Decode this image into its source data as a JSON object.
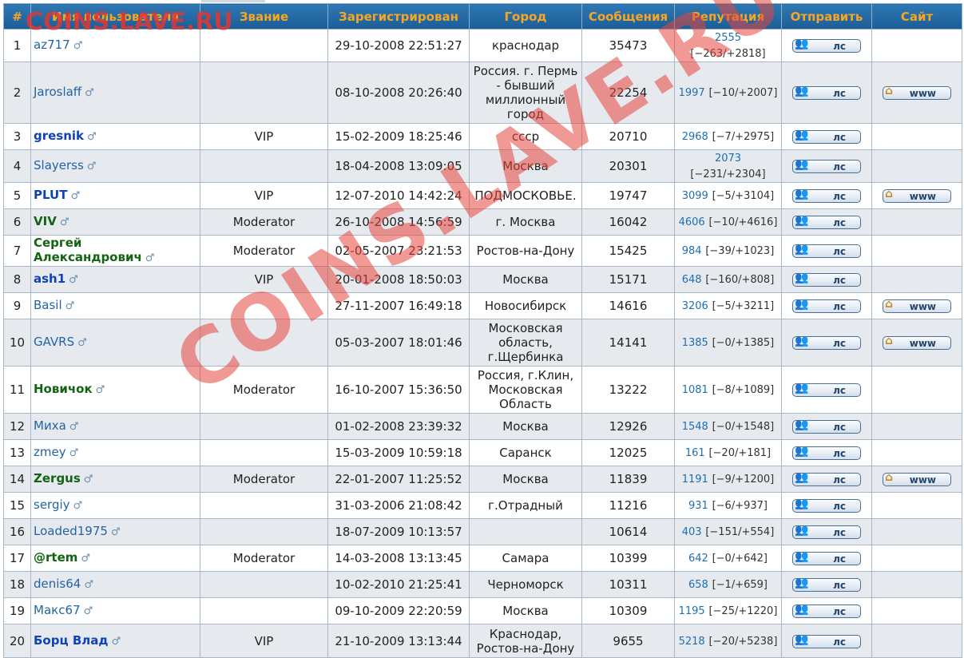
{
  "watermark_small": "COINS.LAVE.RU",
  "watermark_big": "COINS.LAVE.RU",
  "columns": [
    "#",
    "Имя пользователя",
    "Звание",
    "Зарегистрирован",
    "Город",
    "Сообщения",
    "Репутация",
    "Отправить",
    "Сайт"
  ],
  "pm_label": "лс",
  "www_label": "www",
  "rows": [
    {
      "n": "1",
      "name": "az717",
      "style": "",
      "rank": "",
      "reg": "29-10-2008 22:51:27",
      "city": "краснодар",
      "posts": "35473",
      "rep": "2555",
      "repd": "[−263/+2818]",
      "www": false
    },
    {
      "n": "2",
      "name": "Jaroslaff",
      "style": "",
      "rank": "",
      "reg": "08-10-2008 20:26:40",
      "city": "Россия. г. Пермь - бывший миллионный город",
      "posts": "22254",
      "rep": "1997",
      "repd": "[−10/+2007]",
      "www": true
    },
    {
      "n": "3",
      "name": "gresnik",
      "style": "b-blue",
      "rank": "VIP",
      "reg": "15-02-2009 18:25:46",
      "city": "ссср",
      "posts": "20710",
      "rep": "2968",
      "repd": "[−7/+2975]",
      "www": false
    },
    {
      "n": "4",
      "name": "Slayerss",
      "style": "",
      "rank": "",
      "reg": "18-04-2008 13:09:05",
      "city": "Москва",
      "posts": "20301",
      "rep": "2073",
      "repd": "[−231/+2304]",
      "www": false
    },
    {
      "n": "5",
      "name": "PLUT",
      "style": "b-blue",
      "rank": "VIP",
      "reg": "12-07-2010 14:42:24",
      "city": "ПОДМОСКОВЬЕ.",
      "posts": "19747",
      "rep": "3099",
      "repd": "[−5/+3104]",
      "www": true
    },
    {
      "n": "6",
      "name": "VIV",
      "style": "b-green",
      "rank": "Moderator",
      "reg": "26-10-2008 14:56:59",
      "city": "г. Москва",
      "posts": "16042",
      "rep": "4606",
      "repd": "[−10/+4616]",
      "www": false
    },
    {
      "n": "7",
      "name": "Сергей Александрович",
      "style": "b-green",
      "rank": "Moderator",
      "reg": "02-05-2007 23:21:53",
      "city": "Ростов-на-Дону",
      "posts": "15425",
      "rep": "984",
      "repd": "[−39/+1023]",
      "www": false
    },
    {
      "n": "8",
      "name": "ash1",
      "style": "b-blue",
      "rank": "VIP",
      "reg": "20-01-2008 18:50:03",
      "city": "Москва",
      "posts": "15171",
      "rep": "648",
      "repd": "[−160/+808]",
      "www": false
    },
    {
      "n": "9",
      "name": "Basil",
      "style": "",
      "rank": "",
      "reg": "27-11-2007 16:49:18",
      "city": "Новосибирск",
      "posts": "14616",
      "rep": "3206",
      "repd": "[−5/+3211]",
      "www": true
    },
    {
      "n": "10",
      "name": "GAVRS",
      "style": "",
      "rank": "",
      "reg": "05-03-2007 18:01:46",
      "city": "Московская область, г.Щербинка",
      "posts": "14141",
      "rep": "1385",
      "repd": "[−0/+1385]",
      "www": true
    },
    {
      "n": "11",
      "name": "Новичок",
      "style": "b-green",
      "rank": "Moderator",
      "reg": "16-10-2007 15:36:50",
      "city": "Россия, г.Клин, Московская Область",
      "posts": "13222",
      "rep": "1081",
      "repd": "[−8/+1089]",
      "www": false
    },
    {
      "n": "12",
      "name": "Миха",
      "style": "",
      "rank": "",
      "reg": "01-02-2008 23:39:32",
      "city": "Москва",
      "posts": "12926",
      "rep": "1548",
      "repd": "[−0/+1548]",
      "www": false
    },
    {
      "n": "13",
      "name": "zmey",
      "style": "",
      "rank": "",
      "reg": "15-03-2009 10:59:18",
      "city": "Саранск",
      "posts": "12025",
      "rep": "161",
      "repd": "[−20/+181]",
      "www": false
    },
    {
      "n": "14",
      "name": "Zergus",
      "style": "b-green",
      "rank": "Moderator",
      "reg": "22-01-2007 11:25:52",
      "city": "Москва",
      "posts": "11839",
      "rep": "1191",
      "repd": "[−9/+1200]",
      "www": true
    },
    {
      "n": "15",
      "name": "sergiy",
      "style": "",
      "rank": "",
      "reg": "31-03-2006 21:08:42",
      "city": "г.Отрадный",
      "posts": "11216",
      "rep": "931",
      "repd": "[−6/+937]",
      "www": false
    },
    {
      "n": "16",
      "name": "Loaded1975",
      "style": "",
      "rank": "",
      "reg": "18-07-2009 10:13:57",
      "city": "",
      "posts": "10614",
      "rep": "403",
      "repd": "[−151/+554]",
      "www": false
    },
    {
      "n": "17",
      "name": "@rtem",
      "style": "b-green",
      "rank": "Moderator",
      "reg": "14-03-2008 13:13:45",
      "city": "Самара",
      "posts": "10399",
      "rep": "642",
      "repd": "[−0/+642]",
      "www": false
    },
    {
      "n": "18",
      "name": "denis64",
      "style": "",
      "rank": "",
      "reg": "10-02-2010 21:25:41",
      "city": "Черноморск",
      "posts": "10311",
      "rep": "658",
      "repd": "[−1/+659]",
      "www": false
    },
    {
      "n": "19",
      "name": "Макс67",
      "style": "",
      "rank": "",
      "reg": "09-10-2009 22:20:59",
      "city": "Москва",
      "posts": "10309",
      "rep": "1195",
      "repd": "[−25/+1220]",
      "www": false
    },
    {
      "n": "20",
      "name": "Борц Влад",
      "style": "b-blue",
      "rank": "VIP",
      "reg": "21-10-2009 13:13:44",
      "city": "Краснодар, Ростов-на-Дону",
      "posts": "9655",
      "rep": "5218",
      "repd": "[−20/+5238]",
      "www": false
    }
  ]
}
